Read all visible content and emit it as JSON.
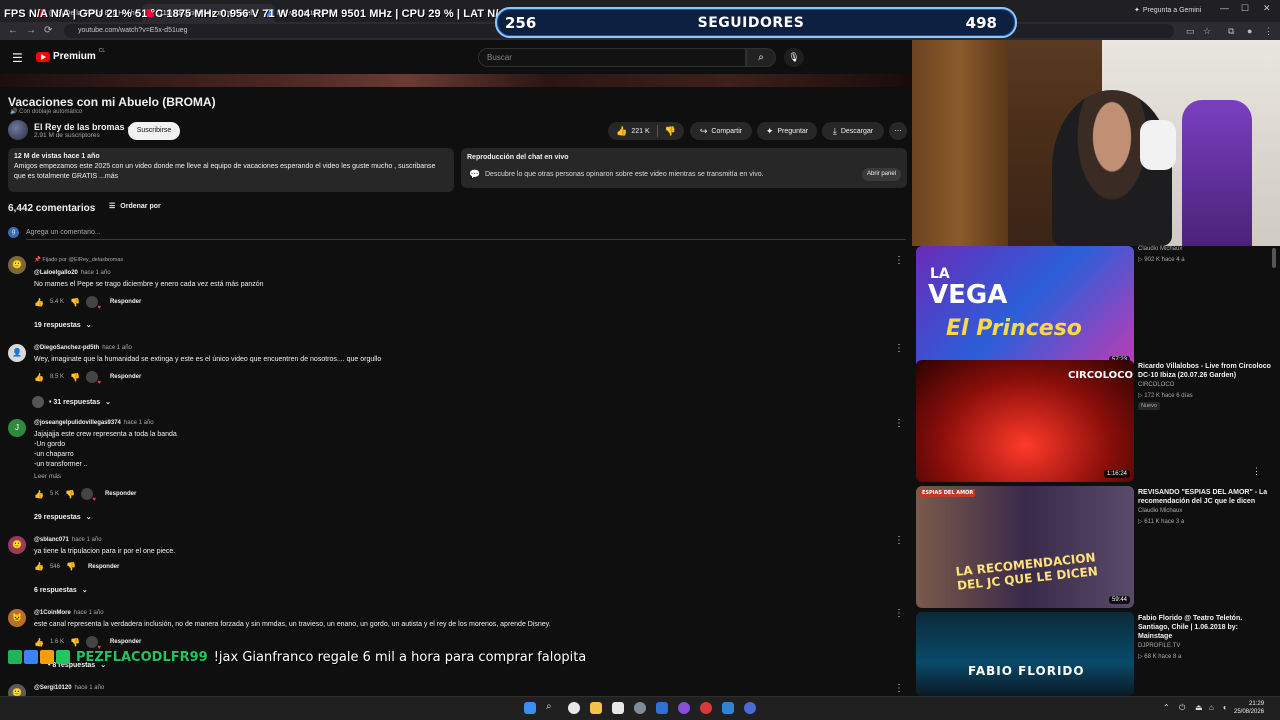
{
  "osd": "FPS  N/A  N/A  | GPU 21 %  51 °C  1875 MHz  0.956 V  71 W  804 RPM  9501 MHz  |  CPU  29 %  |  LAT  N/A  N/A",
  "tabs": [
    {
      "label": "(1/3) De la Swing 828 Hecho..."
    },
    {
      "label": "(111) Vacaciones con mi Abuel..."
    },
    {
      "label": "Nueva pestaña"
    }
  ],
  "followers_overlay": {
    "left": "256",
    "label": "SEGUIDORES",
    "right": "498"
  },
  "browser": {
    "gemini_label": "Pregunta a Gemini",
    "url": "youtube.com/watch?v=E5x-d51ueg"
  },
  "youtube": {
    "logo_text": "Premium",
    "logo_sup": "CL",
    "search_placeholder": "Buscar",
    "video_title": "Vacaciones con mi Abuelo (BROMA)",
    "dubbed_note": "Con doblaje automático",
    "channel": {
      "name": "El Rey de las bromas",
      "subs": "2.91 M de suscriptores",
      "subscribe": "Suscribirse"
    },
    "actions": {
      "likes": "221 K",
      "share": "Compartir",
      "ask": "Preguntar",
      "download": "Descargar"
    },
    "description": {
      "meta": "12 M de vistas  hace 1 año",
      "text": "Amigos empezamos este 2025 con un video donde me lleve al equipo de vacaciones esperando el video les guste mucho , suscribanse que es totalmente GRATIS  ...más"
    },
    "chat_replay": {
      "title": "Reproducción del chat en vivo",
      "text": "Descubre lo que otras personas opinaron sobre este video mientras se transmitía en vivo.",
      "button": "Abrir panel"
    },
    "comments_count": "6,442 comentarios",
    "sort_label": "Ordenar por",
    "add_comment": "Agrega un comentario..."
  },
  "comments": [
    {
      "pinned": "Fijado por @ElRey_delasbromas",
      "author": "@Laloelgallo20",
      "ago": "hace 1 año",
      "text": "No mames el Pepe se trago diciembre y enero cada vez está más panzón",
      "likes": "5.4 K",
      "reply": "Responder",
      "replies": "19 respuestas"
    },
    {
      "author": "@DiegoSanchez-pd5th",
      "ago": "hace 1 año",
      "text": "Wey, imaginate que la humanidad se extinga y este es el único video que encuentren de nosotros.... que orgullo",
      "likes": "8.5 K",
      "reply": "Responder",
      "replies": "• 31 respuestas"
    },
    {
      "author": "@joseangelpulidovillegas9374",
      "ago": "hace 1 año",
      "text": "Jajajajja este crew representa a toda la banda\n-Un gordo\n-un chaparro\n-un transformer ..",
      "readmore": "Leer más",
      "likes": "5 K",
      "reply": "Responder",
      "replies": "29 respuestas"
    },
    {
      "author": "@sblanc071",
      "ago": "hace 1 año",
      "text": "ya tiene la tripulacion para ir por el one piece.",
      "likes": "546",
      "reply": "Responder",
      "replies": "6 respuestas"
    },
    {
      "author": "@1CoinMore",
      "ago": "hace 1 año",
      "text": "este canal representa la verdadera inclusión, no de manera forzada y sin mmdas, un travieso, un enano, un gordo, un autista y el rey de los morenos, aprende Disney.",
      "likes": "1.6 K",
      "reply": "Responder",
      "replies": "• 8 respuestas"
    },
    {
      "author": "@Sergi10120",
      "ago": "hace 1 año"
    }
  ],
  "avatar_letters": {
    "c3": "J"
  },
  "chat_overlay": {
    "user": "PEZFLACODLFR99",
    "message": "!jax Gianfranco regale 6 mil a hora para comprar falopita"
  },
  "related": [
    {
      "thumb_line1": "LA",
      "thumb_line2": "VEGA",
      "thumb_line3": "El Princeso",
      "duration": "57:23",
      "channel": "Claudio Michaux",
      "views": "902 K  hace 4 a"
    },
    {
      "thumb_text": "CIRCOLOCO",
      "duration": "1:16:24",
      "title": "Ricardo Villalobos - Live from Circoloco DC-10 Ibiza (20.07.26 Garden)",
      "channel": "CIRCOLOCO",
      "views": "172 K  hace 6 días",
      "badge": "Nuevo"
    },
    {
      "thumb_text": "LA RECOMENDACION DEL JC QUE LE DICEN",
      "thumb_tag": "ESPIAS DEL AMOR",
      "duration": "59:44",
      "title": "REVISANDO \"ESPIAS DEL AMOR\" - La recomendación del JC que le dicen",
      "channel": "Claudio Michaux",
      "views": "611 K  hace 3 a"
    },
    {
      "thumb_text": "FABIO FLORIDO",
      "title": "Fabio Florido @ Teatro Teletón. Santiago, Chile | 1.06.2018 by: Mainstage",
      "channel": "DJPROFILE.TV",
      "views": "68 K  hace 8 a"
    }
  ],
  "clock": {
    "time": "21:29",
    "date": "25/08/2026"
  }
}
